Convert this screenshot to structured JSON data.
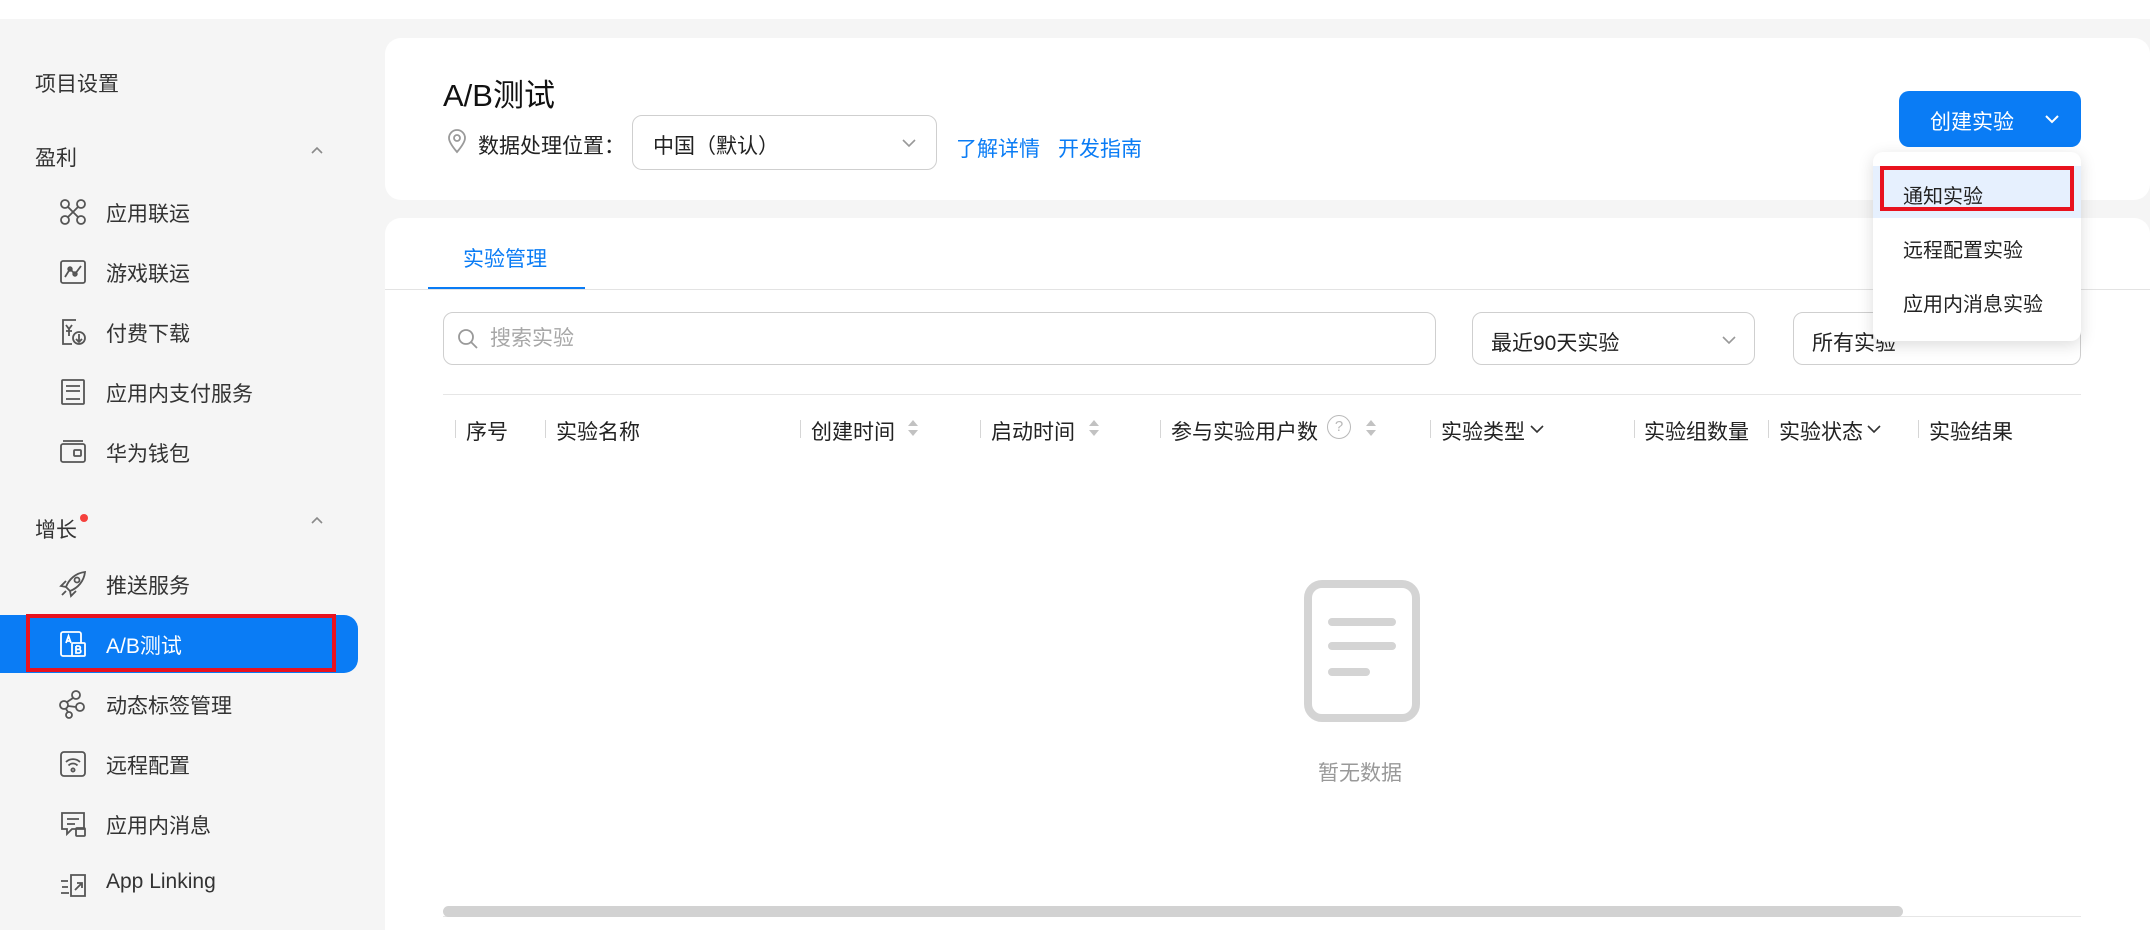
{
  "sidebar": {
    "project_settings": "项目设置",
    "group_profit": {
      "label": "盈利",
      "items": [
        {
          "label": "应用联运",
          "icon": "app-distribution-icon"
        },
        {
          "label": "游戏联运",
          "icon": "game-distribution-icon"
        },
        {
          "label": "付费下载",
          "icon": "paid-download-icon"
        },
        {
          "label": "应用内支付服务",
          "icon": "in-app-payment-icon"
        },
        {
          "label": "华为钱包",
          "icon": "wallet-icon"
        }
      ]
    },
    "group_growth": {
      "label": "增长",
      "items": [
        {
          "label": "推送服务",
          "icon": "rocket-icon"
        },
        {
          "label": "A/B测试",
          "icon": "ab-test-icon"
        },
        {
          "label": "动态标签管理",
          "icon": "dynamic-tag-icon"
        },
        {
          "label": "远程配置",
          "icon": "remote-config-icon"
        },
        {
          "label": "应用内消息",
          "icon": "in-app-message-icon"
        },
        {
          "label": "App Linking",
          "icon": "app-linking-icon"
        }
      ]
    }
  },
  "header": {
    "title": "A/B测试",
    "location_label": "数据处理位置：",
    "region_value": "中国（默认）",
    "learn_more": "了解详情",
    "dev_guide": "开发指南",
    "create_button": "创建实验"
  },
  "create_menu": {
    "items": [
      "通知实验",
      "远程配置实验",
      "应用内消息实验"
    ]
  },
  "tabs": {
    "active": "实验管理"
  },
  "filters": {
    "search_placeholder": "搜索实验",
    "time_range": "最近90天实验",
    "type_filter": "所有实验"
  },
  "table": {
    "columns": [
      "序号",
      "实验名称",
      "创建时间",
      "启动时间",
      "参与实验用户数",
      "实验类型",
      "实验组数量",
      "实验状态",
      "实验结果"
    ],
    "empty_text": "暂无数据"
  },
  "colors": {
    "accent": "#0a7cf5",
    "highlight_box": "#e8121e",
    "notification_dot": "#f5413d"
  }
}
